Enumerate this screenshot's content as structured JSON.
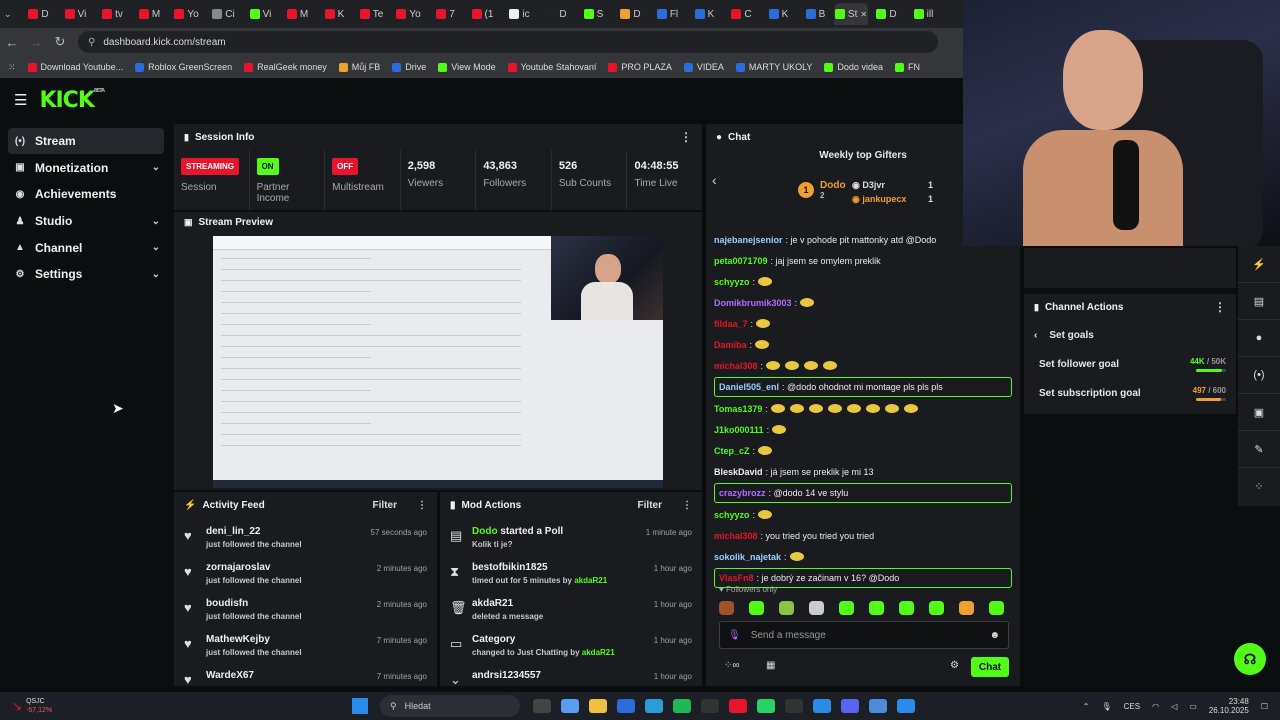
{
  "browser": {
    "url": "dashboard.kick.com/stream",
    "tabs": [
      "D",
      "Vi",
      "tv",
      "M",
      "Yo",
      "Ci",
      "Vi",
      "M",
      "K",
      "Te",
      "Yo",
      "7",
      "(1",
      "ic",
      "D",
      "S",
      "D",
      "Fl",
      "K",
      "C",
      "K",
      "B",
      "St",
      "D",
      "ill"
    ],
    "bookmarks": [
      "Download Youtube...",
      "Roblox GreenScreen",
      "RealGeek money",
      "Můj FB",
      "Drive",
      "View Mode",
      "Youtube Stahovaní",
      "PRO PLAZA",
      "VIDEA",
      "MARTY UKOLY",
      "Dodo videa",
      "FN"
    ]
  },
  "header": {
    "logo": "KICK",
    "beta": "BETA"
  },
  "sidebar": {
    "items": [
      {
        "label": "Stream",
        "icon": "(•)",
        "chevron": false
      },
      {
        "label": "Monetization",
        "icon": "▣",
        "chevron": true
      },
      {
        "label": "Achievements",
        "icon": "◉",
        "chevron": false
      },
      {
        "label": "Studio",
        "icon": "♟",
        "chevron": true
      },
      {
        "label": "Channel",
        "icon": "▲",
        "chevron": true
      },
      {
        "label": "Settings",
        "icon": "⚙",
        "chevron": true
      }
    ]
  },
  "session": {
    "title": "Session Info",
    "stats": [
      {
        "badge": "STREAMING",
        "badge_color": "#e8142b",
        "label": "Session"
      },
      {
        "badge": "ON",
        "badge_color": "#53fc18",
        "label": "Partner Income"
      },
      {
        "badge": "OFF",
        "badge_color": "#e8142b",
        "label": "Multistream"
      },
      {
        "value": "2,598",
        "label": "Viewers"
      },
      {
        "value": "43,863",
        "label": "Followers"
      },
      {
        "value": "526",
        "label": "Sub Counts"
      },
      {
        "value": "04:48:55",
        "label": "Time Live"
      }
    ]
  },
  "preview": {
    "title": "Stream Preview"
  },
  "activity": {
    "title": "Activity Feed",
    "filter": "Filter",
    "items": [
      {
        "user": "deni_lin_22",
        "action": "just followed the channel",
        "time": "57 seconds ago"
      },
      {
        "user": "zornajaroslav",
        "action": "just followed the channel",
        "time": "2 minutes ago"
      },
      {
        "user": "boudisfn",
        "action": "just followed the channel",
        "time": "2 minutes ago"
      },
      {
        "user": "MathewKejby",
        "action": "just followed the channel",
        "time": "7 minutes ago"
      },
      {
        "user": "WardeX67",
        "action": "",
        "time": "7 minutes ago"
      }
    ]
  },
  "mod": {
    "title": "Mod Actions",
    "filter": "Filter",
    "items": [
      {
        "icon": "▤",
        "user": "Dodo",
        "action_main": " started a Poll",
        "action": "Kolik ti je?",
        "action_user": "",
        "time": "1 minute ago"
      },
      {
        "icon": "⧗",
        "user": "bestofbikin1825",
        "action_main": "",
        "action": "timed out for 5 minutes by ",
        "action_user": "akdaR21",
        "time": "1 hour ago"
      },
      {
        "icon": "🗑",
        "user": "akdaR21",
        "action_main": "",
        "action": "deleted a message",
        "action_user": "",
        "time": "1 hour ago"
      },
      {
        "icon": "▭",
        "user": "Category",
        "action_main": "",
        "action": "changed to Just Chatting by ",
        "action_user": "akdaR21",
        "time": "1 hour ago"
      },
      {
        "icon": "⌄",
        "user": "andrsi1234557",
        "action_main": "",
        "action": "",
        "action_user": "",
        "time": "1 hour ago"
      }
    ]
  },
  "chat": {
    "title": "Chat",
    "gifters_title": "Weekly top Gifters",
    "gifters": [
      {
        "rank": "1",
        "name": "Dodo",
        "count": "2"
      },
      {
        "name": "D3jvr",
        "count": "1"
      },
      {
        "name": "jankupecx",
        "count": "1"
      }
    ],
    "messages": [
      {
        "user": "najebanejsenior",
        "color": "#9ad0ff",
        "text": ": je v pohode pit mattonky atd @Dodo",
        "emotes": 0,
        "hl": false
      },
      {
        "user": "peta0071709",
        "color": "#53fc18",
        "text": ": jaj jsem se omylem preklik",
        "emotes": 0,
        "hl": false
      },
      {
        "user": "schyyzo",
        "color": "#53fc18",
        "text": ":",
        "emotes": 1,
        "hl": false
      },
      {
        "user": "Domikbrumik3003",
        "color": "#b06cff",
        "text": ":",
        "emotes": 1,
        "hl": false
      },
      {
        "user": "fildaa_7",
        "color": "#e8142b",
        "text": ":",
        "emotes": 1,
        "hl": false
      },
      {
        "user": "Damiba",
        "color": "#e8142b",
        "text": ":",
        "emotes": 1,
        "hl": false
      },
      {
        "user": "michal308",
        "color": "#e8142b",
        "text": ":",
        "emotes": 4,
        "hl": false
      },
      {
        "user": "Daniel505_enl",
        "color": "#9ad0ff",
        "text": ": @dodo ohodnot mi montage pls pls pls",
        "emotes": 0,
        "hl": true
      },
      {
        "user": "Tomas1379",
        "color": "#53fc18",
        "text": ":",
        "emotes": 8,
        "hl": false
      },
      {
        "user": "J1ko000111",
        "color": "#53fc18",
        "text": ":",
        "emotes": 1,
        "hl": false
      },
      {
        "user": "Ctep_cZ",
        "color": "#53fc18",
        "text": ":",
        "emotes": 1,
        "hl": false
      },
      {
        "user": "BleskDavid",
        "color": "#f0f0f0",
        "text": ": já jsem se preklik je mi 13",
        "emotes": 0,
        "hl": false
      },
      {
        "user": "crazybrozz",
        "color": "#b06cff",
        "text": ": @dodo 14 ve stylu",
        "emotes": 0,
        "hl": true
      },
      {
        "user": "schyyzo",
        "color": "#53fc18",
        "text": ":",
        "emotes": 1,
        "hl": false
      },
      {
        "user": "michal308",
        "color": "#e8142b",
        "text": ": you tried  you tried  you tried",
        "emotes": 0,
        "hl": false
      },
      {
        "user": "sokolik_najetak",
        "color": "#9ad0ff",
        "text": ":",
        "emotes": 1,
        "hl": false
      },
      {
        "user": "VlasFn8",
        "color": "#e8142b",
        "text": ": je dobrý ze začinam v 16? @Dodo",
        "emotes": 0,
        "hl": true
      }
    ],
    "followers_only": "Followers only",
    "input_placeholder": "Send a message",
    "send": "Chat"
  },
  "channel_actions": {
    "title": "Channel Actions",
    "back": "Set goals",
    "goals": [
      {
        "label": "Set follower goal",
        "value": "44K / 50K",
        "value_main": "44K",
        "value_sub": " / 50K",
        "fraction": 0.88,
        "color": "#53fc18"
      },
      {
        "label": "Set subscription goal",
        "value": "497 / 600",
        "value_main": "497",
        "value_sub": " / 600",
        "fraction": 0.83,
        "color": "#f0a030"
      }
    ]
  },
  "taskbar": {
    "stock_name": "QSJC",
    "stock_change": "-57,12%",
    "search": "Hledat",
    "lang": "CES",
    "time": "23:48",
    "date": "26.10.2025"
  }
}
